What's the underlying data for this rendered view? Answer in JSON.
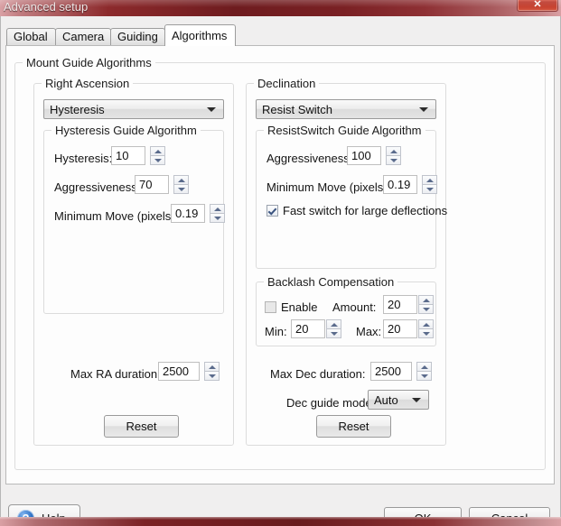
{
  "window": {
    "title": "Advanced setup",
    "close_label": "✕"
  },
  "tabs": [
    {
      "label": "Global",
      "active": false
    },
    {
      "label": "Camera",
      "active": false
    },
    {
      "label": "Guiding",
      "active": false
    },
    {
      "label": "Algorithms",
      "active": true
    }
  ],
  "outer_group": {
    "legend": "Mount Guide Algorithms"
  },
  "right_ascension": {
    "legend": "Right Ascension",
    "algorithm_value": "Hysteresis",
    "algorithm_options": [
      "Hysteresis"
    ],
    "sub_group": {
      "legend": "Hysteresis Guide Algorithm",
      "hysteresis_label": "Hysteresis:",
      "hysteresis_value": "10",
      "aggressiveness_label": "Aggressiveness:",
      "aggressiveness_value": "70",
      "minimum_move_label": "Minimum Move (pixels):",
      "minimum_move_value": "0.19"
    },
    "max_ra_duration_label": "Max RA duration:",
    "max_ra_duration_value": "2500",
    "reset_label": "Reset"
  },
  "declination": {
    "legend": "Declination",
    "algorithm_value": "Resist Switch",
    "algorithm_options": [
      "Resist Switch"
    ],
    "sub_group": {
      "legend": "ResistSwitch Guide Algorithm",
      "aggressiveness_label": "Aggressiveness:",
      "aggressiveness_value": "100",
      "minimum_move_label": "Minimum Move (pixels):",
      "minimum_move_value": "0.19",
      "fast_switch_label": "Fast switch for large deflections",
      "fast_switch_checked": true
    },
    "backlash": {
      "legend": "Backlash Compensation",
      "enable_label": "Enable",
      "enable_checked": false,
      "amount_label": "Amount:",
      "amount_value": "20",
      "min_label": "Min:",
      "min_value": "20",
      "max_label": "Max:",
      "max_value": "20"
    },
    "max_dec_duration_label": "Max Dec duration:",
    "max_dec_duration_value": "2500",
    "dec_guide_mode_label": "Dec guide mode:",
    "dec_guide_mode_value": "Auto",
    "dec_guide_mode_options": [
      "Auto"
    ],
    "reset_label": "Reset"
  },
  "footer": {
    "help_label": "Help",
    "help_icon_glyph": "?",
    "ok_label": "OK",
    "cancel_label": "Cancel"
  }
}
